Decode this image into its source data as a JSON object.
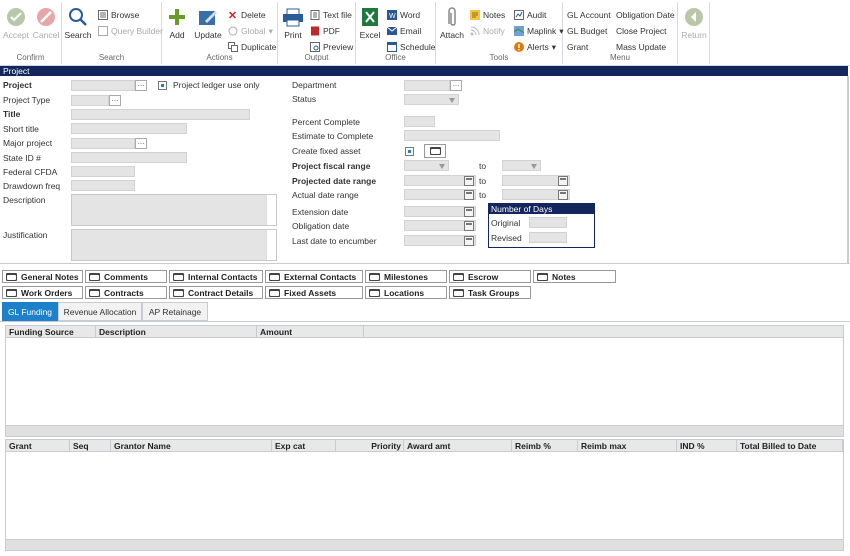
{
  "toolbar": {
    "confirm": {
      "label": "Confirm",
      "accept": "Accept",
      "cancel": "Cancel"
    },
    "search": {
      "label": "Search",
      "search": "Search",
      "browse": "Browse",
      "query_builder": "Query Builder"
    },
    "actions": {
      "label": "Actions",
      "add": "Add",
      "update": "Update",
      "delete": "Delete",
      "global": "Global",
      "duplicate": "Duplicate"
    },
    "output": {
      "label": "Output",
      "print": "Print",
      "text_file": "Text file",
      "pdf": "PDF",
      "preview": "Preview"
    },
    "office": {
      "label": "Office",
      "excel": "Excel",
      "word": "Word",
      "email": "Email",
      "schedule": "Schedule"
    },
    "tools": {
      "label": "Tools",
      "attach": "Attach",
      "notes": "Notes",
      "notify": "Notify",
      "audit": "Audit",
      "maplink": "Maplink",
      "alerts": "Alerts"
    },
    "menu": {
      "label": "Menu",
      "gl_account": "GL Account",
      "gl_budget": "GL Budget",
      "grant": "Grant",
      "obligation_date": "Obligation Date",
      "close_project": "Close Project",
      "mass_update": "Mass Update"
    },
    "return": "Return"
  },
  "section_title": "Project",
  "form": {
    "project": "Project",
    "ledger_only": "Project ledger use only",
    "project_type": "Project Type",
    "title": "Title",
    "short_title": "Short title",
    "major_project": "Major project",
    "state_id": "State ID #",
    "federal_cfda": "Federal CFDA",
    "drawdown_freq": "Drawdown freq",
    "description": "Description",
    "justification": "Justification",
    "department": "Department",
    "status": "Status",
    "percent_complete": "Percent Complete",
    "estimate_to_complete": "Estimate to Complete",
    "create_fixed_asset": "Create fixed asset",
    "fiscal_range": "Project fiscal range",
    "date_range": "Projected date range",
    "actual_range": "Actual date range",
    "to": "to",
    "extension_date": "Extension date",
    "obligation_date": "Obligation date",
    "last_date": "Last date to encumber",
    "days": {
      "title": "Number of Days",
      "original": "Original",
      "revised": "Revised"
    }
  },
  "tabs_row1": [
    "General Notes",
    "Comments",
    "Internal Contacts",
    "External Contacts",
    "Milestones",
    "Escrow",
    "Notes"
  ],
  "tabs_row2": [
    "Work Orders",
    "Contracts",
    "Contract Details",
    "Fixed Assets",
    "Locations",
    "Task Groups"
  ],
  "subtabs": [
    "GL Funding",
    "Revenue Allocation",
    "AP Retainage"
  ],
  "grid1": {
    "cols": [
      "Funding Source",
      "Description",
      "Amount"
    ]
  },
  "grid2": {
    "cols": [
      "Grant",
      "Seq",
      "Grantor Name",
      "Exp cat",
      "Priority",
      "Award amt",
      "Reimb %",
      "Reimb max",
      "IND %",
      "Total Billed to Date"
    ]
  },
  "colors": {
    "header": "#13275d",
    "accent": "#1e80c8"
  }
}
